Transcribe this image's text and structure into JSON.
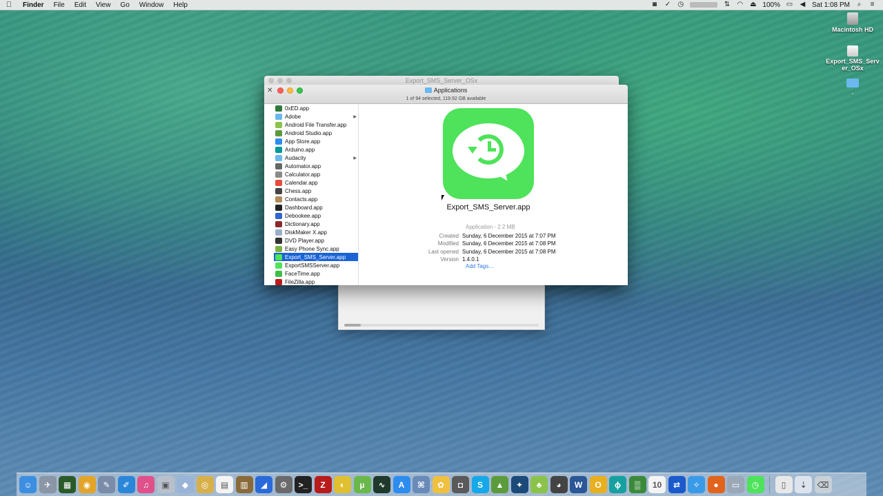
{
  "menubar": {
    "items": [
      "Finder",
      "File",
      "Edit",
      "View",
      "Go",
      "Window",
      "Help"
    ],
    "battery": "100%",
    "clock": "Sat 1:08 PM"
  },
  "desktop": {
    "icons": [
      {
        "label": "Macintosh HD",
        "icon": "hard-drive-icon"
      },
      {
        "label": "Export_SMS_Server_OSx",
        "icon": "disk-image-icon"
      },
      {
        "label": ".",
        "icon": "folder-icon"
      }
    ]
  },
  "back_window": {
    "title": "Export_SMS_Server_OSx"
  },
  "finder": {
    "title": "Applications",
    "status": "1 of 94 selected, 119.92 GB available",
    "items": [
      {
        "label": "0xED.app",
        "color": "#2f7a3a",
        "folder": false
      },
      {
        "label": "Adobe",
        "color": "#6ab8ee",
        "folder": true
      },
      {
        "label": "Android File Transfer.app",
        "color": "#8bc34a",
        "folder": false
      },
      {
        "label": "Android Studio.app",
        "color": "#5c9b3c",
        "folder": false
      },
      {
        "label": "App Store.app",
        "color": "#2d8cf0",
        "folder": false
      },
      {
        "label": "Arduino.app",
        "color": "#00979d",
        "folder": false
      },
      {
        "label": "Audacity",
        "color": "#6ab8ee",
        "folder": true
      },
      {
        "label": "Automator.app",
        "color": "#666666",
        "folder": false
      },
      {
        "label": "Calculator.app",
        "color": "#8a8a8a",
        "folder": false
      },
      {
        "label": "Calendar.app",
        "color": "#e84a3c",
        "folder": false
      },
      {
        "label": "Chess.app",
        "color": "#444444",
        "folder": false
      },
      {
        "label": "Contacts.app",
        "color": "#b08a5a",
        "folder": false
      },
      {
        "label": "Dashboard.app",
        "color": "#222222",
        "folder": false
      },
      {
        "label": "Debookee.app",
        "color": "#3366cc",
        "folder": false
      },
      {
        "label": "Dictionary.app",
        "color": "#8b2a2a",
        "folder": false
      },
      {
        "label": "DiskMaker X.app",
        "color": "#9ab0c8",
        "folder": false
      },
      {
        "label": "DVD Player.app",
        "color": "#333333",
        "folder": false
      },
      {
        "label": "Easy Phone Sync.app",
        "color": "#7cb342",
        "folder": false
      },
      {
        "label": "Export_SMS_Server.app",
        "color": "#4ee35a",
        "folder": false,
        "selected": true
      },
      {
        "label": "ExportSMSServer.app",
        "color": "#4ee35a",
        "folder": false
      },
      {
        "label": "FaceTime.app",
        "color": "#3fbf4a",
        "folder": false
      },
      {
        "label": "FileZilla.app",
        "color": "#b81b1b",
        "folder": false
      }
    ],
    "preview": {
      "name": "Export_SMS_Server.app",
      "kind": "Application - 2.2 MB",
      "rows": [
        {
          "label": "Created",
          "value": "Sunday, 6 December 2015 at 7:07 PM"
        },
        {
          "label": "Modified",
          "value": "Sunday, 6 December 2015 at 7:08 PM"
        },
        {
          "label": "Last opened",
          "value": "Sunday, 6 December 2015 at 7:08 PM"
        },
        {
          "label": "Version",
          "value": "1.4.0.1"
        }
      ],
      "add_tags": "Add Tags…"
    }
  },
  "dock": {
    "apps": [
      {
        "name": "finder-icon",
        "color": "#3c8ee0",
        "glyph": "☺"
      },
      {
        "name": "launchpad-icon",
        "color": "#8a95a6",
        "glyph": "✈"
      },
      {
        "name": "mission-control-icon",
        "color": "#2a5a2a",
        "glyph": "▦"
      },
      {
        "name": "chrome-icon",
        "color": "#e2a52a",
        "glyph": "◉"
      },
      {
        "name": "xcode-tools-icon",
        "color": "#7a8ca8",
        "glyph": "✎"
      },
      {
        "name": "xcode-icon",
        "color": "#2c86d8",
        "glyph": "✐"
      },
      {
        "name": "itunes-icon",
        "color": "#e0508a",
        "glyph": "♫"
      },
      {
        "name": "preview-icon",
        "color": "#b8c0cc",
        "glyph": "▣"
      },
      {
        "name": "virtualbox-icon",
        "color": "#9ab4d8",
        "glyph": "◆"
      },
      {
        "name": "sequel-icon",
        "color": "#d8b04a",
        "glyph": "◎"
      },
      {
        "name": "textedit-icon",
        "color": "#f4f4f4",
        "glyph": "▤"
      },
      {
        "name": "notes-icon",
        "color": "#8a6a3a",
        "glyph": "▥"
      },
      {
        "name": "studio-icon",
        "color": "#2a6ad8",
        "glyph": "◢"
      },
      {
        "name": "system-preferences-icon",
        "color": "#6a6a6a",
        "glyph": "⚙"
      },
      {
        "name": "terminal-icon",
        "color": "#222222",
        "glyph": ">_"
      },
      {
        "name": "filezilla-icon",
        "color": "#b81b1b",
        "glyph": "Z"
      },
      {
        "name": "sketchup-icon",
        "color": "#e0c030",
        "glyph": "◐"
      },
      {
        "name": "utorrent-icon",
        "color": "#6ab84a",
        "glyph": "µ"
      },
      {
        "name": "activity-monitor-icon",
        "color": "#1f3a2a",
        "glyph": "∿"
      },
      {
        "name": "app-store-icon",
        "color": "#2d8cf0",
        "glyph": "A"
      },
      {
        "name": "network-utility-icon",
        "color": "#6a8ab8",
        "glyph": "⌘"
      },
      {
        "name": "photos-icon",
        "color": "#f0c040",
        "glyph": "✿"
      },
      {
        "name": "image-capture-icon",
        "color": "#5a5a5a",
        "glyph": "◘"
      },
      {
        "name": "skype-icon",
        "color": "#16a8e8",
        "glyph": "S"
      },
      {
        "name": "android-studio-icon",
        "color": "#5c9b3c",
        "glyph": "▲"
      },
      {
        "name": "mysql-workbench-icon",
        "color": "#1c4a78",
        "glyph": "✦"
      },
      {
        "name": "android-icon",
        "color": "#8bc34a",
        "glyph": "♣"
      },
      {
        "name": "github-icon",
        "color": "#444444",
        "glyph": "◕"
      },
      {
        "name": "word-icon",
        "color": "#2b5797",
        "glyph": "W"
      },
      {
        "name": "coin-icon",
        "color": "#e8b020",
        "glyph": "O"
      },
      {
        "name": "droid-icon",
        "color": "#16a0a0",
        "glyph": "ϕ"
      },
      {
        "name": "console-icon",
        "color": "#3a8a3a",
        "glyph": "▒"
      },
      {
        "name": "calendar-icon",
        "color": "#f4f4f4",
        "glyph": "10"
      },
      {
        "name": "teamviewer-icon",
        "color": "#1a5acc",
        "glyph": "⇄"
      },
      {
        "name": "safari-icon",
        "color": "#3a9ae8",
        "glyph": "✧"
      },
      {
        "name": "firefox-icon",
        "color": "#e2641c",
        "glyph": "●"
      },
      {
        "name": "disk-utility-icon",
        "color": "#9aa8b8",
        "glyph": "▭"
      },
      {
        "name": "export-sms-server-icon",
        "color": "#4ee35a",
        "glyph": "◷"
      },
      {
        "name": "documents-folder-icon",
        "color": "#e8e8e8",
        "glyph": "▯"
      },
      {
        "name": "downloads-folder-icon",
        "color": "#dde4ee",
        "glyph": "⇣"
      },
      {
        "name": "trash-icon",
        "color": "#c8d0d8",
        "glyph": "⌫"
      }
    ]
  }
}
